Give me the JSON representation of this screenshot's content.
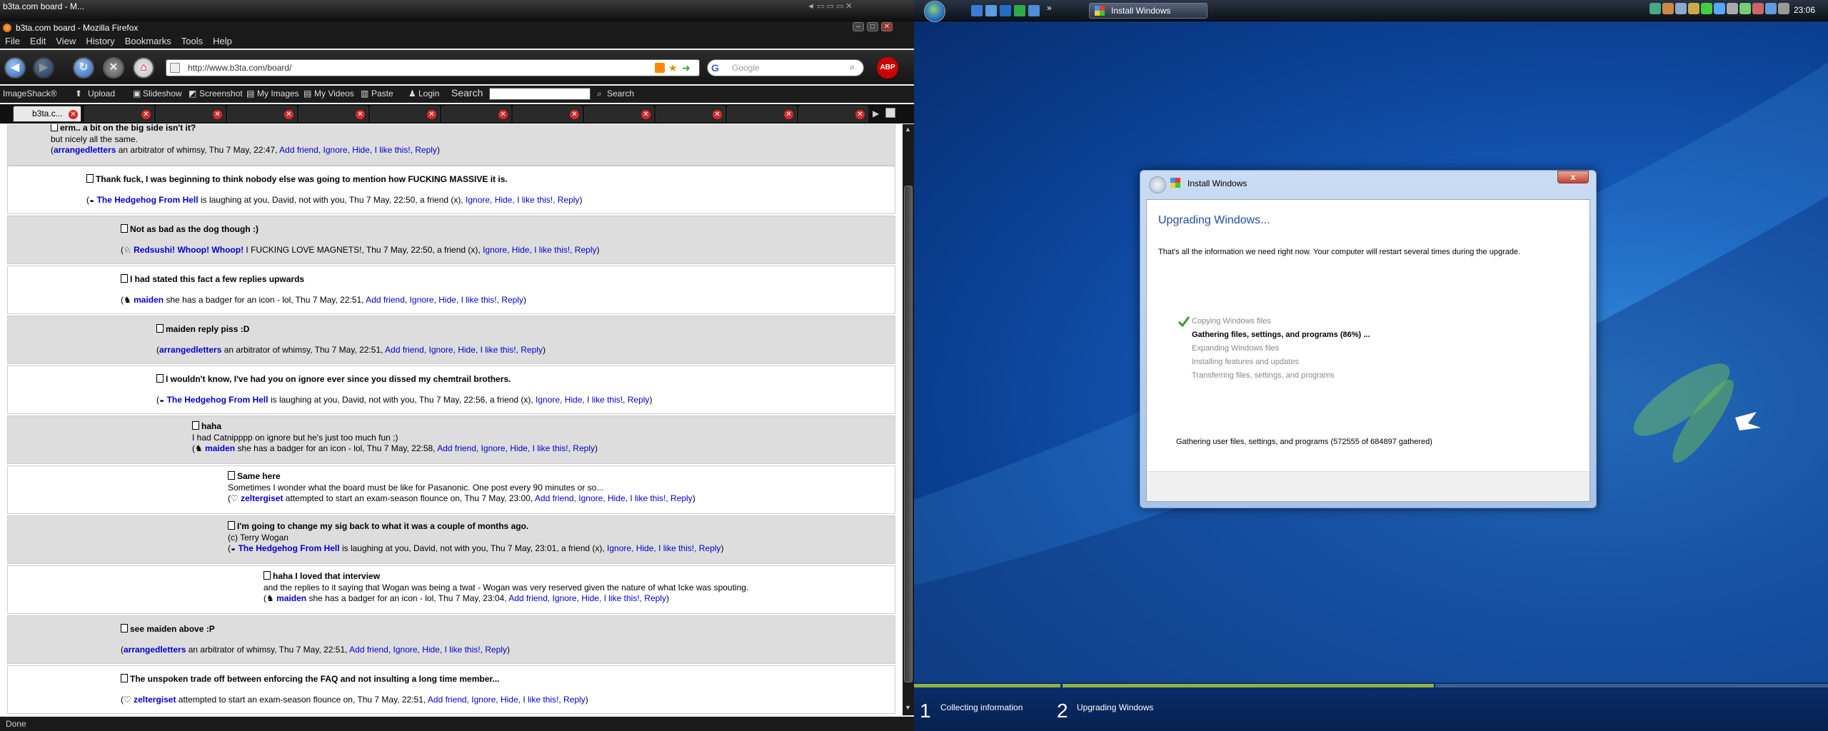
{
  "firefox": {
    "tab_title": "b3ta.com board - M...",
    "window_title": "b3ta.com board - Mozilla Firefox",
    "menu": [
      "File",
      "Edit",
      "View",
      "History",
      "Bookmarks",
      "Tools",
      "Help"
    ],
    "url": "http://www.b3ta.com/board/",
    "search_placeholder": "Google",
    "abp": "ABP",
    "imagebar": {
      "brand": "ImageShack®",
      "upload": "Upload",
      "slideshow": "Slideshow",
      "screenshot": "Screenshot",
      "myimages": "My Images",
      "myvideos": "My Videos",
      "paste": "Paste",
      "login": "Login",
      "search_label": "Search",
      "search_btn": "Search"
    },
    "active_tab": "b3ta.c...",
    "status": "Done"
  },
  "posts": [
    {
      "title": "erm.. a bit on the big side isn't it?",
      "body": "but nicely all the same.",
      "user": "arrangedletters",
      "tail": " an arbitrator of whimsy, Thu 7 May, 22:47, ",
      "links": "Add friend, Ignore, Hide, I like this!, Reply"
    },
    {
      "title": "Thank fuck, I was beginning to think nobody else was going to mention how FUCKING MASSIVE it is.",
      "user": "The Hedgehog From Hell",
      "tail": " is laughing at you, David, not with you, Thu 7 May, 22:50, a friend (x), ",
      "links": "Ignore, Hide, I like this!, Reply"
    },
    {
      "title": "Not as bad as the dog though :)",
      "user": "Redsushi! Whoop! Whoop!",
      "tail": " I FUCKING LOVE MAGNETS!, Thu 7 May, 22:50, a friend (x), ",
      "links": "Ignore, Hide, I like this!, Reply"
    },
    {
      "title": "I had stated this fact a few replies upwards",
      "user": "maiden",
      "tail": " she has a badger for an icon - lol, Thu 7 May, 22:51, ",
      "links": "Add friend, Ignore, Hide, I like this!, Reply"
    },
    {
      "title": "maiden reply piss :D",
      "user": "arrangedletters",
      "tail": " an arbitrator of whimsy, Thu 7 May, 22:51, ",
      "links": "Add friend, Ignore, Hide, I like this!, Reply"
    },
    {
      "title": "I wouldn't know, I've had you on ignore ever since you dissed my chemtrail brothers.",
      "user": "The Hedgehog From Hell",
      "tail": " is laughing at you, David, not with you, Thu 7 May, 22:56, a friend (x), ",
      "links": "Ignore, Hide, I like this!, Reply"
    },
    {
      "title": "haha",
      "body": "I had Catnipppp on ignore but he's just too much fun ;)",
      "user": "maiden",
      "tail": " she has a badger for an icon - lol, Thu 7 May, 22:58, ",
      "links": "Add friend, Ignore, Hide, I like this!, Reply"
    },
    {
      "title": "Same here",
      "body": "Sometimes I wonder what the board must be like for Pasanonic. One post every 90 minutes or so...",
      "user": "zeltergiset",
      "tail": " attempted to start an exam-season flounce on, Thu 7 May, 23:00, ",
      "links": "Add friend, Ignore, Hide, I like this!, Reply"
    },
    {
      "title": "I'm going to change my sig back to what it was a couple of months ago.",
      "body": "(c) Terry Wogan",
      "user": "The Hedgehog From Hell",
      "tail": " is laughing at you, David, not with you, Thu 7 May, 23:01, a friend (x), ",
      "links": "Ignore, Hide, I like this!, Reply"
    },
    {
      "title": "haha I loved that interview",
      "body": "and the replies to it saying that Wogan was being a twat - Wogan was very reserved given the nature of what Icke was spouting.",
      "user": "maiden",
      "tail": " she has a badger for an icon - lol, Thu 7 May, 23:04, ",
      "links": "Add friend, Ignore, Hide, I like this!, Reply"
    },
    {
      "title": "see maiden above :P",
      "user": "arrangedletters",
      "tail": " an arbitrator of whimsy, Thu 7 May, 22:51, ",
      "links": "Add friend, Ignore, Hide, I like this!, Reply"
    },
    {
      "title": "The unspoken trade off between enforcing the FAQ and not insulting a long time member...",
      "user": "zeltergiset",
      "tail": " attempted to start an exam-season flounce on, Thu 7 May, 22:51, ",
      "links": "Add friend, Ignore, Hide, I like this!, Reply"
    }
  ],
  "windows": {
    "taskbar_button": "Install Windows",
    "clock": "23:06",
    "dialog_title": "Install Windows",
    "close_label": "x",
    "heading": "Upgrading Windows...",
    "message": "That's all the information we need right now. Your computer will restart several times during the upgrade.",
    "steps": [
      "Copying Windows files",
      "Gathering files, settings, and programs (86%) ...",
      "Expanding Windows files",
      "Installing features and updates",
      "Transferring files, settings, and programs"
    ],
    "detail": "Gathering user files, settings, and programs (572555 of 684897 gathered)",
    "phase1_num": "1",
    "phase1_label": "Collecting information",
    "phase2_num": "2",
    "phase2_label": "Upgrading Windows"
  },
  "colors": {
    "link": "#0000cc",
    "progress_green": "#8db43c"
  }
}
